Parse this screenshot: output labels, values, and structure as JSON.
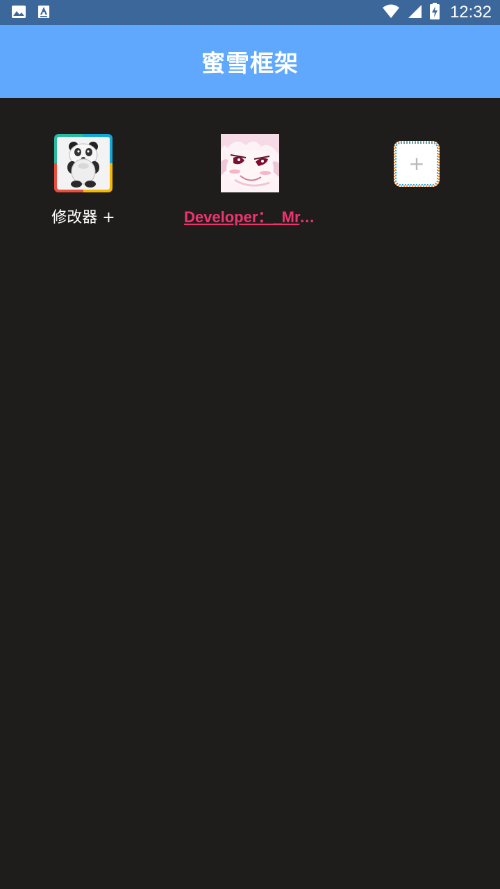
{
  "status_bar": {
    "time": "12:32",
    "icons": [
      "image-notification-icon",
      "font-notification-icon",
      "wifi-icon",
      "signal-icon",
      "battery-charging-icon"
    ]
  },
  "app_bar": {
    "title": "蜜雪框架"
  },
  "grid": {
    "items": [
      {
        "label": "修改器 +",
        "icon": "panda-app-icon"
      },
      {
        "label": "Developer：_Mr.…",
        "icon": "anime-avatar-icon",
        "color": "#f0336d"
      },
      {
        "label": "+",
        "icon": "add-icon"
      }
    ]
  },
  "colors": {
    "status_bar": "#3b679b",
    "app_bar": "#5fa8fd",
    "background": "#1e1d1c",
    "developer_link": "#f0336d"
  }
}
